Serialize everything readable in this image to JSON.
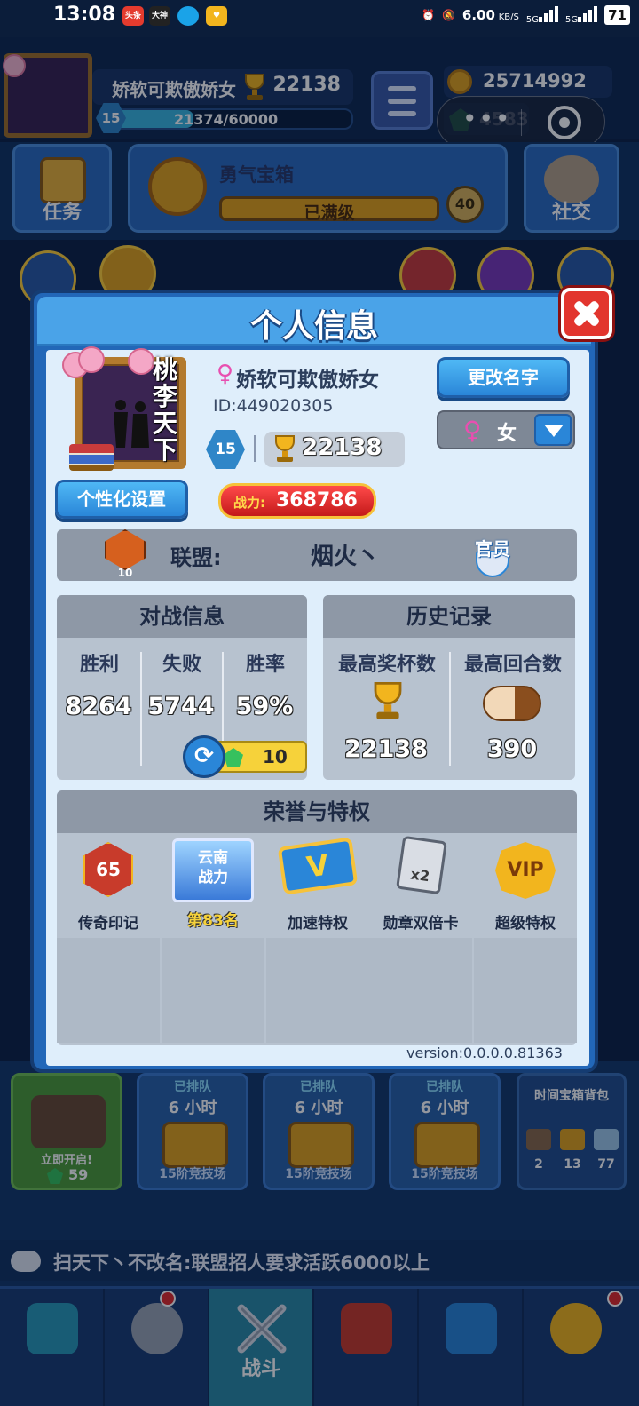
{
  "status_bar": {
    "time": "13:08",
    "app_icons": [
      "头条",
      "大神"
    ],
    "net_speed": "6.00",
    "net_unit": "KB/S",
    "sig1": "5G",
    "sig2": "5G",
    "battery": "71"
  },
  "top": {
    "player_name": "娇软可欺傲娇女",
    "trophies": "22138",
    "level": "15",
    "xp": "21374/60000",
    "xp_fraction": 0.356,
    "coins": "25714992",
    "gems": "4583"
  },
  "bg_row": {
    "task_label": "任务",
    "chest_title": "勇气宝箱",
    "chest_status": "已满级",
    "chest_badge": "40",
    "social_label": "社交"
  },
  "modal": {
    "title": "个人信息",
    "name": "娇软可欺傲娇女",
    "female_symbol": "♀",
    "id": "ID:449020305",
    "level": "15",
    "trophies": "22138",
    "power_label": "战力:",
    "power_value": "368786",
    "custom_button": "个性化设置",
    "rename_button": "更改名字",
    "gender": "女",
    "alliance": {
      "label": "联盟:",
      "name": "烟火丶",
      "emblem_level": "10",
      "role": "官员"
    },
    "battle": {
      "title": "对战信息",
      "headers": [
        "胜利",
        "失败",
        "胜率"
      ],
      "values": [
        "8264",
        "5744",
        "59%"
      ],
      "refresh_cost": "10"
    },
    "history": {
      "title": "历史记录",
      "headers": [
        "最高奖杯数",
        "最高回合数"
      ],
      "values": [
        "22138",
        "390"
      ]
    },
    "honor": {
      "title": "荣誉与特权",
      "items": [
        {
          "label": "传奇印记",
          "badge": "65"
        },
        {
          "label": "",
          "line1": "云南",
          "line2": "战力",
          "rank": "第83名"
        },
        {
          "label": "加速特权",
          "badge": "V"
        },
        {
          "label": "勋章双倍卡",
          "badge": "x2"
        },
        {
          "label": "超级特权",
          "badge": "VIP"
        }
      ]
    },
    "version": "version:0.0.0.0.81363",
    "frame_calligraphy": "桃李天下"
  },
  "lower": {
    "open_card": {
      "label": "立即开启!",
      "gems": "59"
    },
    "chests": [
      {
        "queue": "已排队",
        "hours": "6 小时",
        "arena": "15阶竞技场"
      },
      {
        "queue": "已排队",
        "hours": "6 小时",
        "arena": "15阶竞技场"
      },
      {
        "queue": "已排队",
        "hours": "6 小时",
        "arena": "15阶竞技场"
      }
    ],
    "bag": {
      "title": "时间宝箱背包",
      "counts": [
        "2",
        "13",
        "77"
      ]
    }
  },
  "chat": {
    "message": "扫天下丶不改名:联盟招人要求活跃6000以上"
  },
  "nav": {
    "battle_label": "战斗"
  }
}
